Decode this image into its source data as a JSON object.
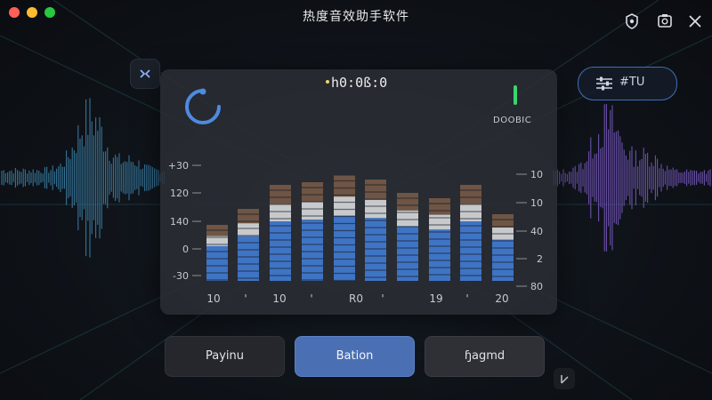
{
  "window": {
    "title": "热度音效助手软件",
    "controls": [
      "close",
      "minimize",
      "zoom"
    ],
    "header_icons": [
      "shield-settings-icon",
      "photo-icon",
      "close-icon"
    ]
  },
  "panel": {
    "timer": "h0:0ß:0",
    "status": "DOOBIC",
    "left_axis_labels": [
      "+30",
      "120",
      "140",
      "0",
      "-30"
    ],
    "right_axis_labels": [
      "10",
      "10",
      "40",
      "2",
      "80"
    ],
    "bottom_axis_labels": [
      "10",
      "'",
      "10",
      "'",
      "R0",
      "'",
      "19",
      "'",
      "20"
    ]
  },
  "eq_pill": {
    "label": "#TU"
  },
  "buttons": {
    "left": "Payinu",
    "center": "Bation",
    "right": "ɧagmd"
  },
  "meters": {
    "levels": [
      0.42,
      0.54,
      0.72,
      0.74,
      0.79,
      0.76,
      0.66,
      0.62,
      0.72,
      0.5
    ],
    "colors": {
      "blue": "#3f74c4",
      "gray": "#c7c9cc",
      "brown": "#6e5545",
      "accent": "#4a6fb2"
    }
  }
}
